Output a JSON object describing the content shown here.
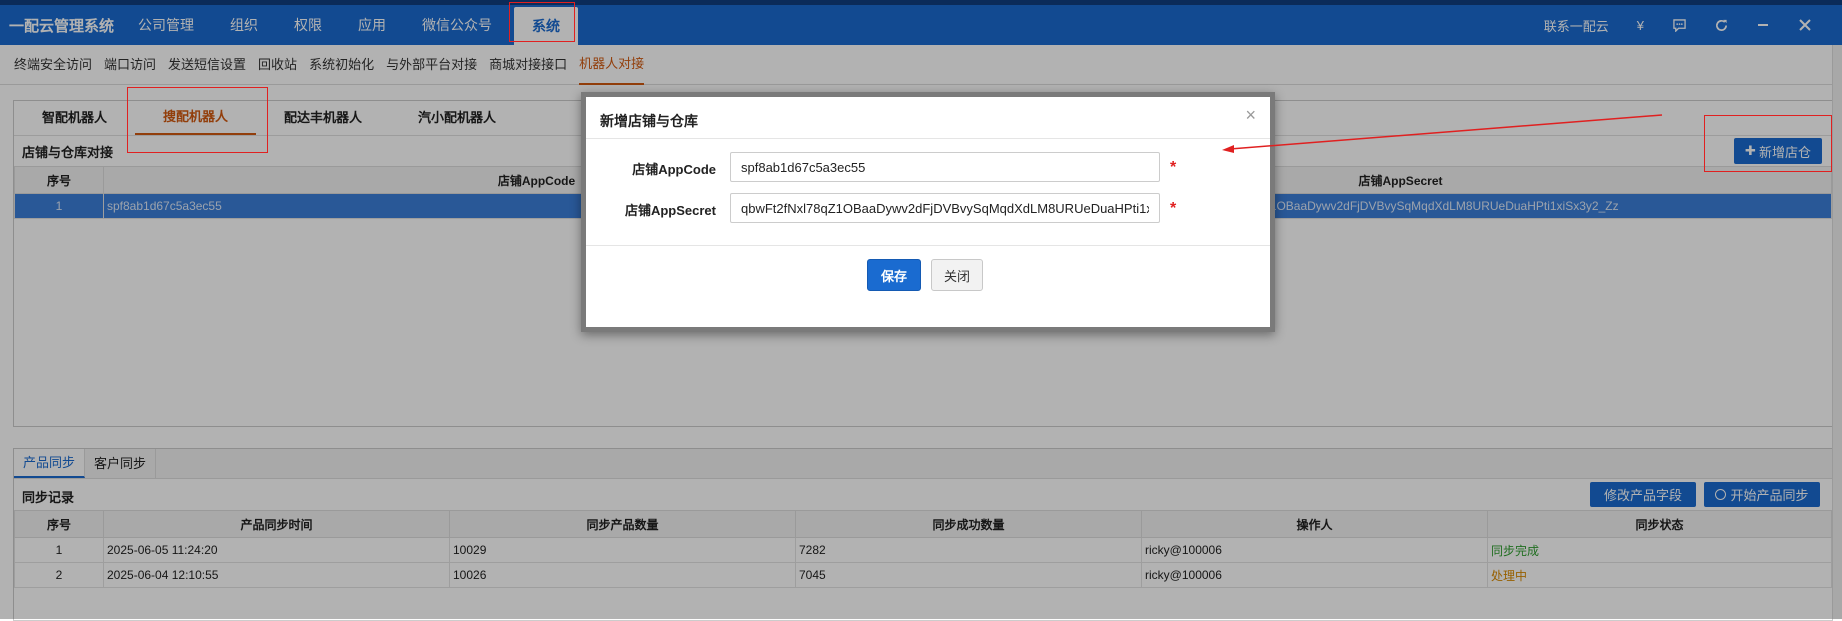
{
  "topbar": {
    "brand": "一配云管理系统",
    "nav": [
      "公司管理",
      "组织",
      "权限",
      "应用",
      "微信公众号",
      "系统"
    ],
    "active_nav": "系统",
    "contact": "联系一配云",
    "yen": "¥",
    "icons": [
      "chat-icon",
      "refresh-icon",
      "minimize-icon",
      "close-icon"
    ]
  },
  "subnav": [
    "终端安全访问",
    "端口访问",
    "发送短信设置",
    "回收站",
    "系统初始化",
    "与外部平台对接",
    "商城对接接口",
    "机器人对接"
  ],
  "subnav_active": "机器人对接",
  "robot_tabs": [
    "智配机器人",
    "搜配机器人",
    "配达丰机器人",
    "汽小配机器人"
  ],
  "robot_tab_active": "搜配机器人",
  "store_section": {
    "title": "店铺与仓库对接",
    "add_button": "新增店仓",
    "columns": [
      "序号",
      "店铺AppCode",
      "店铺AppSecret"
    ],
    "rows": [
      {
        "index": "1",
        "app_code": "spf8ab1d67c5a3ec55",
        "app_secret": "qbwFt2fNxl78qZ1OBaaDywv2dFjDVBvySqMqdXdLM8URUeDuaHPti1xiSx3y2_Zz"
      }
    ]
  },
  "dialog": {
    "title": "新增店铺与仓库",
    "close": "×",
    "app_code_label": "店铺AppCode",
    "app_code_value": "spf8ab1d67c5a3ec55",
    "app_secret_label": "店铺AppSecret",
    "app_secret_value": "qbwFt2fNxl78qZ1OBaaDywv2dFjDVBvySqMqdXdLM8URUeDuaHPti1xiSx3y2_Zz",
    "required_mark": "*",
    "save": "保存",
    "cancel": "关闭"
  },
  "sync_tabs": [
    "产品同步",
    "客户同步"
  ],
  "sync_tab_active": "产品同步",
  "sync_section": {
    "title": "同步记录",
    "edit_fields_button": "修改产品字段",
    "start_sync_button": "开始产品同步",
    "columns": [
      "序号",
      "产品同步时间",
      "同步产品数量",
      "同步成功数量",
      "操作人",
      "同步状态"
    ],
    "rows": [
      {
        "index": "1",
        "time": "2025-06-05 11:24:20",
        "count": "10029",
        "success": "7282",
        "operator": "ricky@100006",
        "status": "同步完成",
        "status_type": "done"
      },
      {
        "index": "2",
        "time": "2025-06-04 12:10:55",
        "count": "10026",
        "success": "7045",
        "operator": "ricky@100006",
        "status": "处理中",
        "status_type": "processing"
      }
    ]
  },
  "colors": {
    "primary": "#1a6bd0",
    "active_tab": "#d25a10",
    "annotation": "#e02020",
    "status_done": "#2f9e2f",
    "status_processing": "#d98a00"
  }
}
